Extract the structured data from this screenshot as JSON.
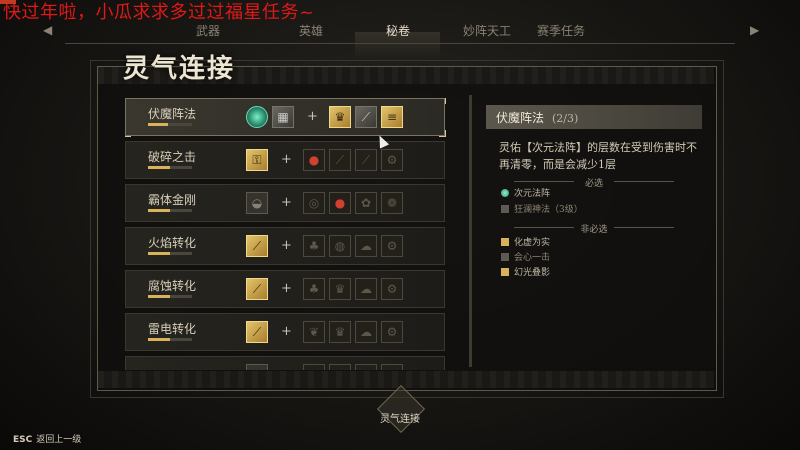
{
  "overlay_caption": "快过年啦，小瓜求求多过过福星任务~",
  "nav": {
    "tabs": [
      {
        "label": "武器"
      },
      {
        "label": "英雄"
      },
      {
        "label": "秘卷"
      },
      {
        "label": "妙阵天工"
      },
      {
        "label": "赛季任务"
      }
    ],
    "active_index": 2
  },
  "panel": {
    "title": "灵气连接"
  },
  "list": [
    {
      "name": "伏魔阵法",
      "progress": 0.45,
      "selected": true
    },
    {
      "name": "破碎之击",
      "progress": 0.5
    },
    {
      "name": "霸体金刚",
      "progress": 0.5
    },
    {
      "name": "火焰转化",
      "progress": 0.5
    },
    {
      "name": "腐蚀转化",
      "progress": 0.5
    },
    {
      "name": "雷电转化",
      "progress": 0.5
    },
    {
      "name": "",
      "progress": 0.3
    }
  ],
  "detail": {
    "title": "伏魔阵法",
    "count": "(2/3)",
    "description": "灵佑【次元法阵】的层数在受到伤害时不再清零，而是会减少1层",
    "required_title": "必选",
    "required": [
      {
        "label": "次元法阵",
        "state": "owned"
      },
      {
        "label": "狂澜神法（3级）",
        "state": "missing"
      }
    ],
    "optional_title": "非必选",
    "optional": [
      {
        "label": "化虚为实",
        "state": "owned"
      },
      {
        "label": "会心一击",
        "state": "missing"
      },
      {
        "label": "幻光叠影",
        "state": "owned"
      }
    ]
  },
  "footer": {
    "esc_key": "ESC",
    "esc_label": "返回上一级",
    "emblem_label": "灵气连接"
  },
  "colors": {
    "accent_gold": "#d9b35a",
    "overlay_red": "#e01818"
  }
}
